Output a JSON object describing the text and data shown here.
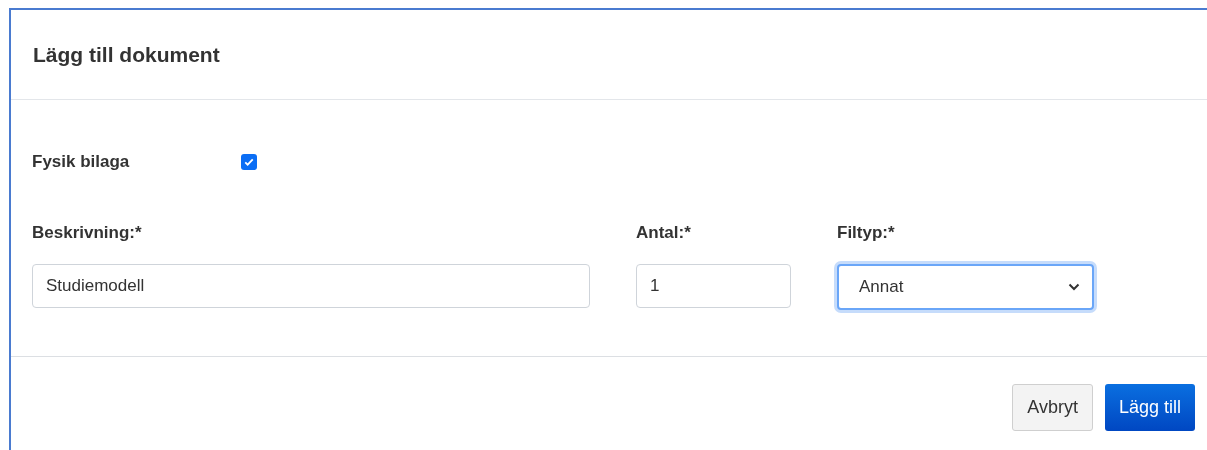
{
  "dialog": {
    "title": "Lägg till dokument",
    "physical_attachment": {
      "label": "Fysik bilaga",
      "checked": true
    },
    "fields": [
      {
        "kind": "text",
        "label": "Beskrivning:*",
        "value": "Studiemodell",
        "focused": false
      },
      {
        "kind": "text",
        "label": "Antal:*",
        "value": "1",
        "focused": false
      },
      {
        "kind": "select",
        "label": "Filtyp:*",
        "value": "Annat",
        "focused": true
      }
    ],
    "buttons": [
      {
        "kind": "secondary",
        "label": "Avbryt"
      },
      {
        "kind": "primary",
        "label": "Lägg till"
      }
    ]
  }
}
